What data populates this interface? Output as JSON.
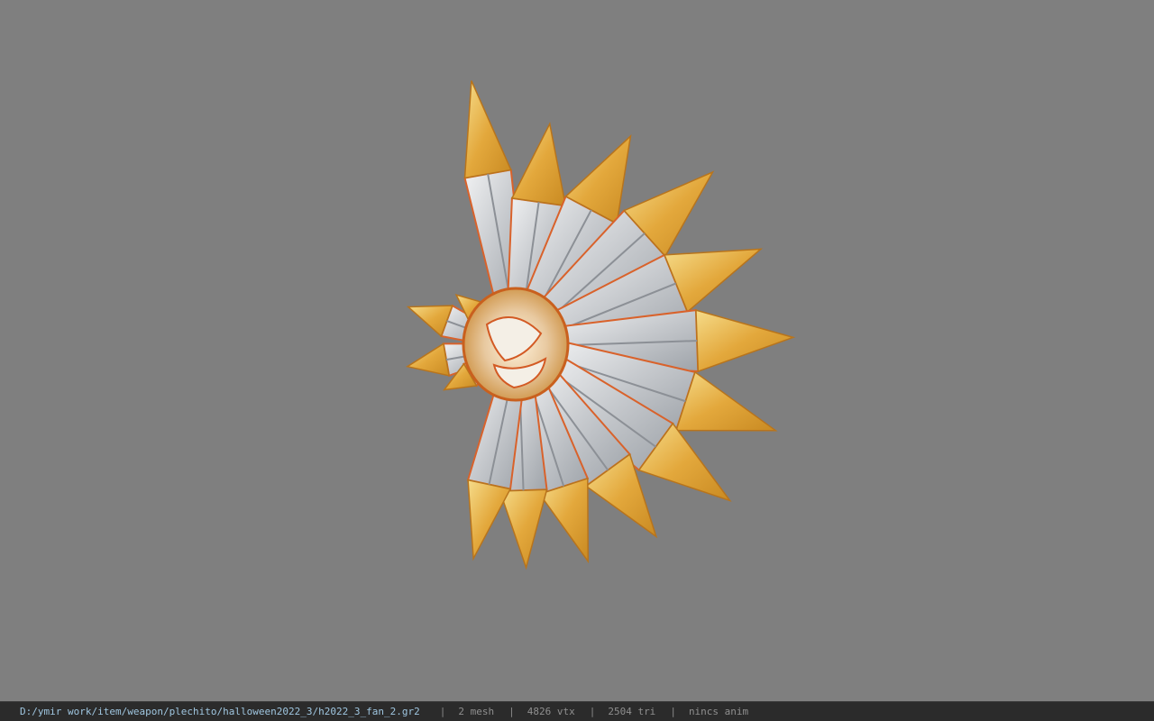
{
  "viewport": {
    "background": "#7f7f7f",
    "model_description_icon": "spiked-fan-model-icon"
  },
  "status_bar": {
    "file_path": "D:/ymir work/item/weapon/plechito/halloween2022_3/h2022_3_fan_2.gr2",
    "separator": "|",
    "mesh_count": "2 mesh",
    "vertex_count": "4826 vtx",
    "triangle_count": "2504 tri",
    "anim_status": "nincs anim"
  },
  "colors": {
    "gold": "#e0a83a",
    "gold_light": "#f3d27a",
    "silver": "#d6d8db",
    "silver_dark": "#8c9096",
    "orange_edge": "#d9622b",
    "status_bg": "#2b2b2b",
    "path_text": "#9fc6e0"
  }
}
